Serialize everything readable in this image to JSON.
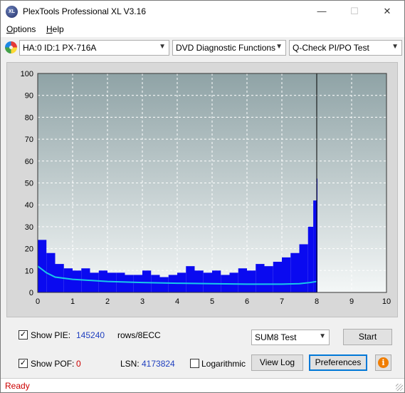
{
  "window": {
    "title": "PlexTools Professional XL V3.16",
    "app_icon": "plextools-logo-icon",
    "app_icon_text": "XL",
    "controls": {
      "minimize": "—",
      "maximize": "☐",
      "close": "✕"
    }
  },
  "menu": {
    "items": [
      {
        "label": "Options",
        "accel": "O"
      },
      {
        "label": "Help",
        "accel": "H"
      }
    ]
  },
  "toolbar": {
    "drive_icon": "disc-drive-icon",
    "drive": "HA:0 ID:1  PX-716A",
    "function": "DVD Diagnostic Functions",
    "test": "Q-Check PI/PO Test"
  },
  "chart_data": {
    "type": "bar",
    "title": "",
    "xlabel": "",
    "ylabel": "",
    "xlim": [
      0,
      10
    ],
    "ylim": [
      0,
      100
    ],
    "x_ticks": [
      "0",
      "1",
      "2",
      "3",
      "4",
      "5",
      "6",
      "7",
      "8",
      "9",
      "10"
    ],
    "y_ticks": [
      "0",
      "10",
      "20",
      "30",
      "40",
      "50",
      "60",
      "70",
      "80",
      "90",
      "100"
    ],
    "grid": true,
    "data_end_x": 8.0,
    "colors": {
      "pie_bars": "#0a0af0",
      "average_line": "#18c8e8",
      "plot_bg_top": "#8fa3a6",
      "plot_bg_bottom": "#f4f7f7",
      "marker_line": "#000000"
    },
    "series": [
      {
        "kind": "bars",
        "x": [
          0.0,
          0.25,
          0.5,
          0.75,
          1.0,
          1.25,
          1.5,
          1.75,
          2.0,
          2.25,
          2.5,
          2.75,
          3.0,
          3.25,
          3.5,
          3.75,
          4.0,
          4.25,
          4.5,
          4.75,
          5.0,
          5.25,
          5.5,
          5.75,
          6.0,
          6.25,
          6.5,
          6.75,
          7.0,
          7.25,
          7.5,
          7.75,
          7.9,
          8.0
        ],
        "values": [
          24,
          18,
          13,
          11,
          10,
          11,
          9,
          10,
          9,
          9,
          8,
          8,
          10,
          8,
          7,
          8,
          9,
          12,
          10,
          9,
          10,
          8,
          9,
          11,
          10,
          13,
          12,
          14,
          16,
          18,
          22,
          30,
          42,
          52
        ]
      },
      {
        "kind": "line",
        "x": [
          0.0,
          0.25,
          0.5,
          1.0,
          1.5,
          2.0,
          3.0,
          4.0,
          5.0,
          6.0,
          7.0,
          7.5,
          7.8,
          8.0
        ],
        "values": [
          12,
          9,
          7,
          6,
          5.5,
          5,
          4.5,
          4.2,
          4,
          3.8,
          3.8,
          4,
          4.5,
          5
        ]
      }
    ]
  },
  "stats": {
    "show_pie_label": "Show PIE:",
    "pie_value": "145240",
    "pie_unit": "rows/8ECC",
    "show_pof_label": "Show POF:",
    "pof_value": "0",
    "lsn_label": "LSN:",
    "lsn_value": "4173824",
    "logarithmic_label": "Logarithmic",
    "show_pie_checked": true,
    "show_pof_checked": true,
    "logarithmic_checked": false,
    "checkmark": "✓"
  },
  "controls": {
    "test_mode": "SUM8 Test",
    "start_label": "Start",
    "view_log_label": "View Log",
    "preferences_label": "Preferences",
    "info_icon": "info-icon",
    "info_glyph": "i"
  },
  "status": {
    "text": "Ready"
  }
}
